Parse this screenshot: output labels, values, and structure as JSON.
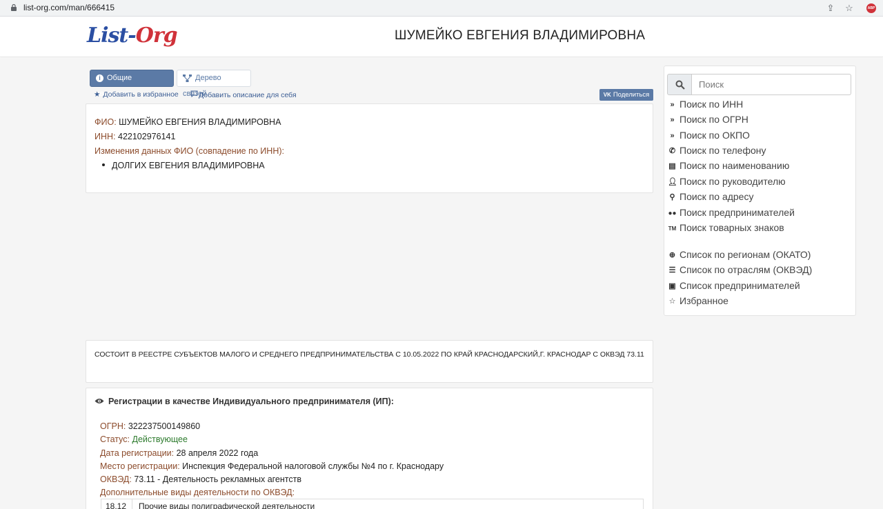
{
  "browser": {
    "url": "list-org.com/man/666415",
    "adblock_label": "ABP"
  },
  "header": {
    "logo_part1": "List-",
    "logo_part2": "Org",
    "title": "ШУМЕЙКО ЕВГЕНИЯ ВЛАДИМИРОВНА"
  },
  "tabs": [
    {
      "label": "Общие сведения:",
      "active": true
    },
    {
      "label": "Дерево связей",
      "active": false
    }
  ],
  "actions": {
    "favorite": "Добавить в избранное",
    "description": "Добавить описание для себя",
    "share": "Поделиться",
    "share_brand": "VK"
  },
  "info": {
    "fio_label": "ФИО:",
    "fio_value": "ШУМЕЙКО ЕВГЕНИЯ ВЛАДИМИРОВНА",
    "inn_label": "ИНН:",
    "inn_value": "422102976141",
    "changes_label": "Изменения данных ФИО (совпадение по ИНН):",
    "changes": [
      "ДОЛГИХ ЕВГЕНИЯ ВЛАДИМИРОВНА"
    ]
  },
  "registry_text": "СОСТОИТ В РЕЕСТРЕ СУБЪЕКТОВ МАЛОГО И СРЕДНЕГО ПРЕДПРИНИМАТЕЛЬСТВА С 10.05.2022 ПО КРАЙ КРАСНОДАРСКИЙ,Г. КРАСНОДАР С ОКВЭД 73.11",
  "ip": {
    "heading": "Регистрации в качестве Индивидуального предпринимателя (ИП):",
    "ogrn_label": "ОГРН:",
    "ogrn_value": "322237500149860",
    "status_label": "Статус:",
    "status_value": "Действующее",
    "reg_date_label": "Дата регистрации:",
    "reg_date_value": "28 апреля 2022 года",
    "place_label": "Место регистрации:",
    "place_value": "Инспекция Федеральной налоговой службы №4 по г. Краснодару",
    "okved_label": "ОКВЭД:",
    "okved_value": "73.11 - Деятельность рекламных агентств",
    "extra_label": "Дополнительные виды деятельности по ОКВЭД:",
    "extra_rows": [
      {
        "code": "18.12",
        "name": "Прочие виды полиграфической деятельности"
      }
    ]
  },
  "sidebar": {
    "search_placeholder": "Поиск",
    "items": [
      {
        "icon": "double-chevron-icon",
        "label": "Поиск по ИНН"
      },
      {
        "icon": "double-chevron-icon",
        "label": "Поиск по ОГРН"
      },
      {
        "icon": "double-chevron-icon",
        "label": "Поиск по ОКПО"
      },
      {
        "icon": "phone-icon",
        "label": "Поиск по телефону"
      },
      {
        "icon": "document-icon",
        "label": "Поиск по наименованию"
      },
      {
        "icon": "user-icon",
        "label": "Поиск по руководителю"
      },
      {
        "icon": "map-marker-icon",
        "label": "Поиск по адресу"
      },
      {
        "icon": "users-icon",
        "label": "Поиск предпринимателей"
      },
      {
        "icon": "trademark-icon",
        "label": "Поиск товарных знаков"
      }
    ],
    "items2": [
      {
        "icon": "globe-icon",
        "label": "Список по регионам (ОКАТО)"
      },
      {
        "icon": "list-icon",
        "label": "Список по отраслям (ОКВЭД)"
      },
      {
        "icon": "id-card-icon",
        "label": "Список предпринимателей"
      },
      {
        "icon": "star-icon",
        "label": "Избранное"
      }
    ]
  },
  "colors": {
    "accent": "#5b7aa6",
    "label": "#8b4a2a",
    "status_active": "#2c7a2c",
    "logo_blue": "#2b4fa3",
    "logo_red": "#d0323a"
  }
}
